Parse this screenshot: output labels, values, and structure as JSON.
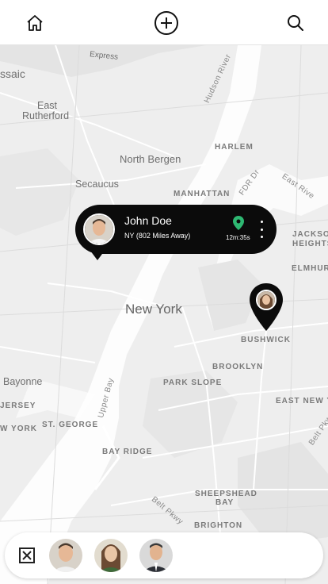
{
  "topbar": {
    "home_icon": "home-icon",
    "add_icon": "plus-circle-icon",
    "search_icon": "search-icon"
  },
  "map": {
    "labels": {
      "passaic": "ssaic",
      "east_rutherford_1": "East",
      "east_rutherford_2": "Rutherford",
      "north_bergen": "North Bergen",
      "secaucus": "Secaucus",
      "harlem": "HARLEM",
      "manhattan": "MANHATTAN",
      "new_york": "New York",
      "jackson_heights_1": "JACKSO",
      "jackson_heights_2": "HEIGHTS",
      "elmhurst": "ELMHURS",
      "bushwick": "BUSHWICK",
      "brooklyn": "BROOKLYN",
      "park_slope": "PARK SLOPE",
      "bayonne": "Bayonne",
      "jersey": "JERSEY",
      "york": "W YORK",
      "st_george": "ST. GEORGE",
      "east_new_york": "EAST NEW Y",
      "bay_ridge": "BAY RIDGE",
      "sheepshead_1": "SHEEPSHEAD",
      "sheepshead_2": "BAY",
      "brighton": "BRIGHTON",
      "hudson_river": "Hudson River",
      "upper_bay": "Upper Bay",
      "fdr": "FDR Dr",
      "east_river": "East Rive",
      "belt_pkwy_1": "Belt Pkwy",
      "belt_pkwy_2": "Belt Pkwy",
      "express": "Express"
    }
  },
  "callout": {
    "name": "John Doe",
    "location": "NY  (802 Miles Away)",
    "elapsed": "12m:35s",
    "pin_color": "#2eb872"
  },
  "tray": {
    "close_icon": "close-box-icon",
    "avatars": [
      "avatar-man-1",
      "avatar-woman",
      "avatar-man-2"
    ]
  }
}
